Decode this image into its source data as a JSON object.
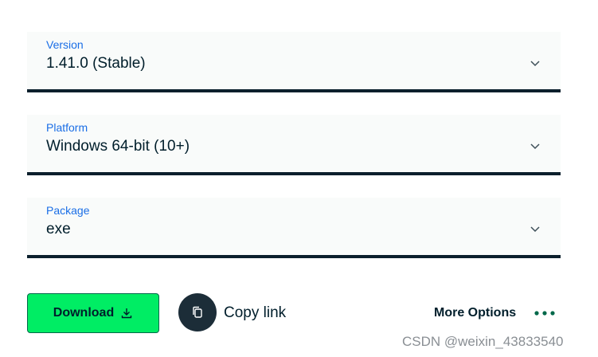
{
  "selects": {
    "version": {
      "label": "Version",
      "value": "1.41.0 (Stable)"
    },
    "platform": {
      "label": "Platform",
      "value": "Windows 64-bit (10+)"
    },
    "package": {
      "label": "Package",
      "value": "exe"
    }
  },
  "actions": {
    "download_label": "Download",
    "copy_link_label": "Copy link",
    "more_options_label": "More Options"
  },
  "icons": {
    "chevron": "chevron-down-icon",
    "download": "download-icon",
    "copy": "copy-icon",
    "more": "ellipsis-icon"
  },
  "colors": {
    "accent_green": "#00ed64",
    "label_blue": "#1a6ee6",
    "dark": "#001e2b",
    "dots_green": "#00684a"
  },
  "watermark": "CSDN @weixin_43833540"
}
